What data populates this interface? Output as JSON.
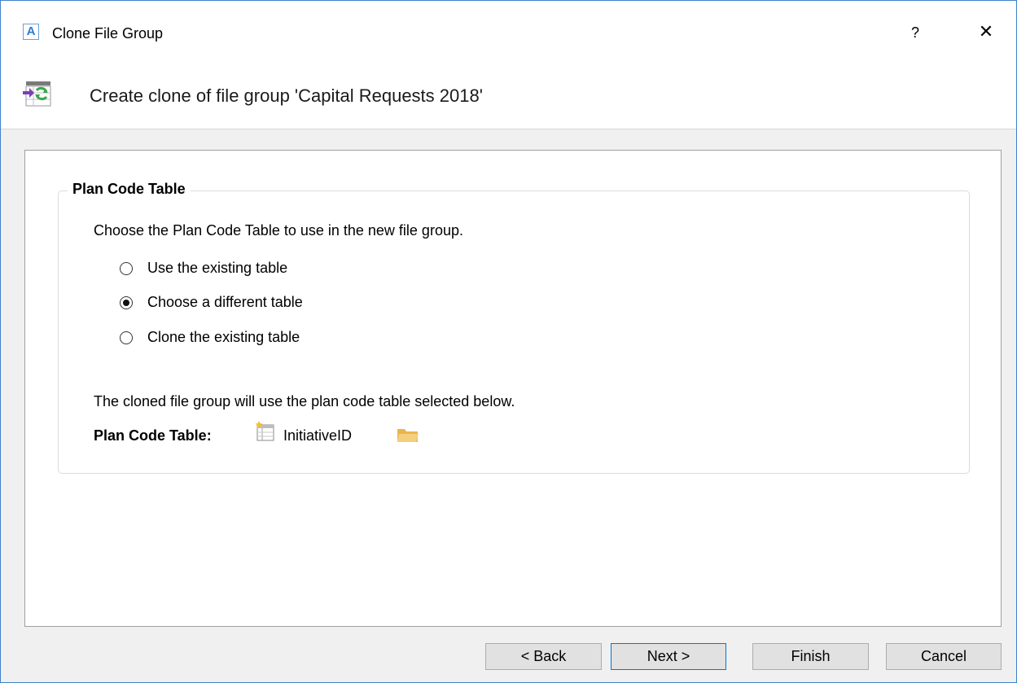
{
  "window": {
    "app_icon_letter": "A",
    "title": "Clone File Group",
    "help_glyph": "?",
    "close_glyph": "✕"
  },
  "header": {
    "text": "Create clone of file group 'Capital Requests 2018'",
    "icon": "clone-file-group-icon"
  },
  "group": {
    "legend": "Plan Code Table",
    "intro": "Choose the Plan Code Table to use in the new file group.",
    "options": [
      {
        "label": "Use the existing table",
        "checked": false
      },
      {
        "label": "Choose a different table",
        "checked": true
      },
      {
        "label": "Clone the existing table",
        "checked": false
      }
    ],
    "note": "The cloned file group will use the plan code table selected below.",
    "plan_code_label": "Plan Code Table:",
    "plan_code_value": "InitiativeID",
    "value_icon": "table-icon",
    "browse_icon": "folder-icon"
  },
  "buttons": {
    "back": "< Back",
    "next": "Next >",
    "finish": "Finish",
    "cancel": "Cancel"
  },
  "colors": {
    "window_border": "#3f82c9",
    "primary_focus": "#0078d7",
    "folder": "#f4c46a"
  }
}
